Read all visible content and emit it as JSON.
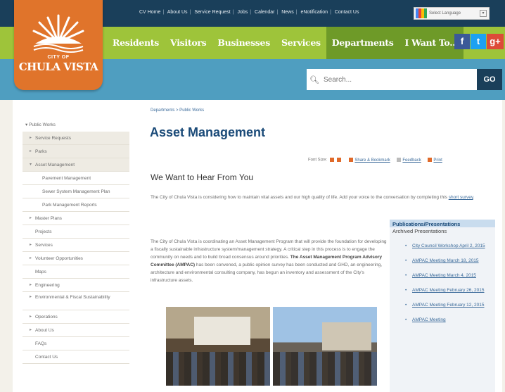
{
  "utility_links": [
    "CV Home",
    "About Us",
    "Service Request",
    "Jobs",
    "Calendar",
    "News",
    "eNotification",
    "Contact Us"
  ],
  "translate": {
    "label": "Select Language"
  },
  "logo": {
    "city_of": "CITY OF",
    "name": "CHULA VISTA"
  },
  "nav": [
    "Residents",
    "Visitors",
    "Businesses",
    "Services",
    "Departments",
    "I Want To..."
  ],
  "social": {
    "facebook": "f",
    "twitter": "t",
    "googleplus": "g+"
  },
  "search": {
    "placeholder": "Search...",
    "button": "GO"
  },
  "breadcrumb": "Departments > Public Works",
  "page_title": "Asset Management",
  "tools": {
    "font_size": "Font Size:",
    "share": "Share & Bookmark",
    "feedback": "Feedback",
    "print": "Print"
  },
  "heading": "We Want to Hear From You",
  "intro": {
    "text": "The City of Chula Vista is considering how to maintain vital assets and our high quality of life. Add your voice to the conversation by completing this",
    "link": "short survey",
    "end": "."
  },
  "body": {
    "text1": "The City of Chula Vista is coordinating an Asset Management Program that will provide the foundation for developing a fiscally sustainable infrastructure system/management strategy. A critical step in this process is to engage the community on needs and to build broad consensus around priorities.",
    "bold": "The Asset Management Program Advisory Committee (AMPAC)",
    "text2": "has been convened, a public opinion survey has been conducted and GHD, an engineering, architecture and environmental consulting company, has begun an inventory and assessment of the City's infrastructure assets."
  },
  "sidebar": [
    {
      "label": "Public Works",
      "level": "top"
    },
    {
      "label": "Service Requests",
      "level": "sub"
    },
    {
      "label": "Parks",
      "level": "sub"
    },
    {
      "label": "Asset Management",
      "level": "sub",
      "open": true
    },
    {
      "label": "Pavement Management",
      "level": "child"
    },
    {
      "label": "Sewer System Management Plan",
      "level": "child"
    },
    {
      "label": "Park Management Reports",
      "level": "child"
    },
    {
      "label": "Master Plans",
      "level": "sub"
    },
    {
      "label": "Projects",
      "level": "plain"
    },
    {
      "label": "Services",
      "level": "sub"
    },
    {
      "label": "Volunteer Opportunities",
      "level": "sub"
    },
    {
      "label": "Maps",
      "level": "plain"
    },
    {
      "label": "Engineering",
      "level": "sub"
    },
    {
      "label": "Environmental & Fiscal Sustainability",
      "level": "sub"
    },
    {
      "label": "Operations",
      "level": "sub"
    },
    {
      "label": "About Us",
      "level": "sub"
    },
    {
      "label": "FAQs",
      "level": "plain"
    },
    {
      "label": "Contact Us",
      "level": "plain"
    }
  ],
  "publications": {
    "title": "Publications/Presentations",
    "subtitle": "Archived Presentations",
    "items": [
      "City Council Workshop April 2, 2015",
      "AMPAC Meeting March 18, 2015",
      "AMPAC Meeting March 4, 2015",
      "AMPAC Meeting February 26, 2015",
      "AMPAC Meeting February 12, 2015",
      "AMPAC Meeting"
    ]
  }
}
